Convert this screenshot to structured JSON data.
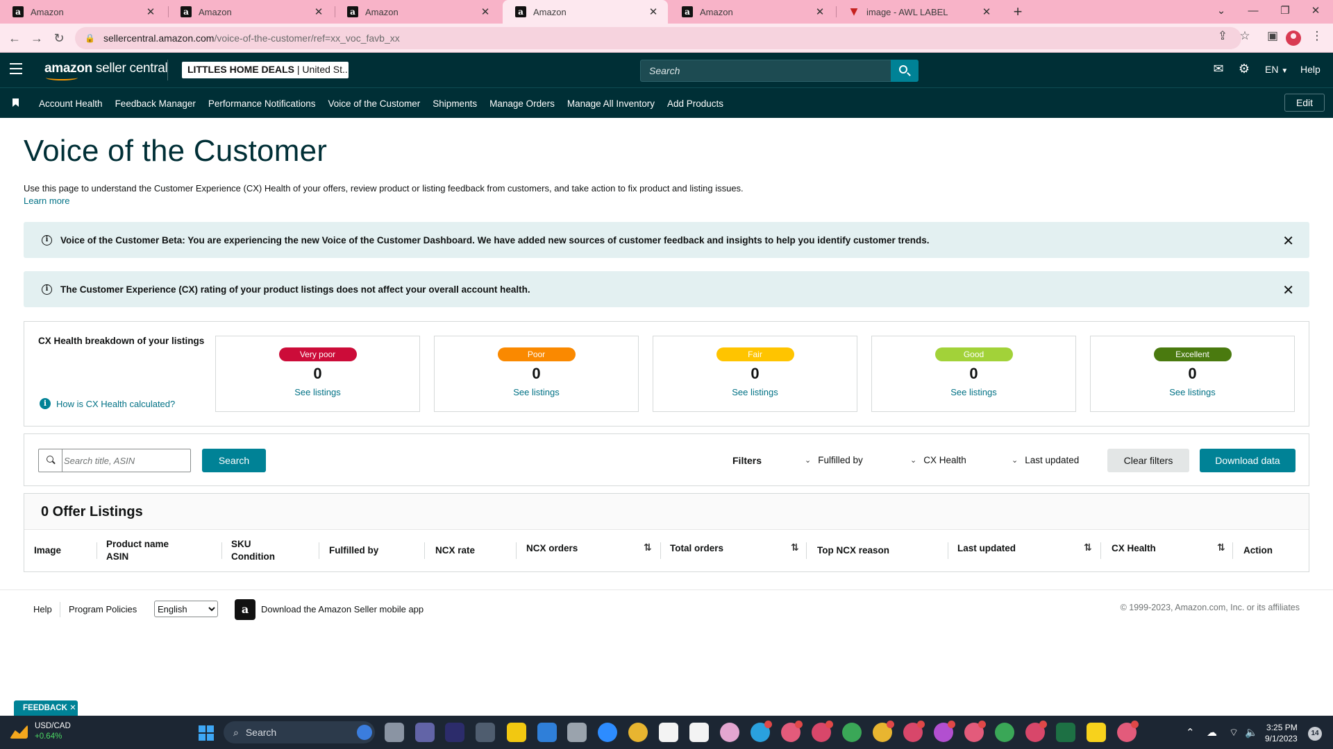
{
  "browser": {
    "tabs": [
      {
        "title": "Amazon",
        "favicon": "amazon-icon",
        "active": false
      },
      {
        "title": "Amazon",
        "favicon": "amazon-icon",
        "active": false
      },
      {
        "title": "Amazon",
        "favicon": "amazon-icon",
        "active": false
      },
      {
        "title": "Amazon",
        "favicon": "amazon-icon",
        "active": true
      },
      {
        "title": "Amazon",
        "favicon": "amazon-icon",
        "active": false
      },
      {
        "title": "image - AWL LABEL",
        "favicon": "awl-label-icon",
        "active": false
      }
    ],
    "url_host": "sellercentral.amazon.com",
    "url_path": "/voice-of-the-customer/ref=xx_voc_favb_xx",
    "tab_color": "#f8b3c8"
  },
  "header": {
    "logo_text_bold": "amazon",
    "logo_text": " seller central",
    "store_name": "LITTLES HOME DEALS",
    "store_region": " | United St...",
    "search_placeholder": "Search",
    "language": "EN",
    "help": "Help",
    "bg_color": "#002f36"
  },
  "nav": {
    "items": [
      "Account Health",
      "Feedback Manager",
      "Performance Notifications",
      "Voice of the Customer",
      "Shipments",
      "Manage Orders",
      "Manage All Inventory",
      "Add Products"
    ],
    "edit_label": "Edit"
  },
  "page": {
    "title": "Voice of the Customer",
    "description": "Use this page to understand the Customer Experience (CX) Health of your offers, review product or listing feedback from customers, and take action to fix product and listing issues.",
    "learn_more": "Learn more"
  },
  "banners": [
    {
      "text": "Voice of the Customer Beta: You are experiencing the new Voice of the Customer Dashboard. We have added new sources of customer feedback and insights to help you identify customer trends."
    },
    {
      "text": "The Customer Experience (CX) rating of your product listings does not affect your overall account health."
    }
  ],
  "cx_health": {
    "title": "CX Health breakdown of your listings",
    "how_link": "How is CX Health calculated?",
    "cards": [
      {
        "label": "Very poor",
        "count": "0",
        "link": "See listings",
        "color": "#cc0c39"
      },
      {
        "label": "Poor",
        "count": "0",
        "link": "See listings",
        "color": "#fa8900"
      },
      {
        "label": "Fair",
        "count": "0",
        "link": "See listings",
        "color": "#ffc400"
      },
      {
        "label": "Good",
        "count": "0",
        "link": "See listings",
        "color": "#a2d239"
      },
      {
        "label": "Excellent",
        "count": "0",
        "link": "See listings",
        "color": "#4a7a0f"
      }
    ]
  },
  "filters": {
    "search_placeholder": "Search title, ASIN",
    "search_button": "Search",
    "filters_label": "Filters",
    "dropdowns": [
      "Fulfilled by",
      "CX Health",
      "Last updated"
    ],
    "clear_button": "Clear filters",
    "download_button": "Download data"
  },
  "listings": {
    "heading": "0 Offer Listings",
    "columns": [
      {
        "line1": "Image",
        "line2": ""
      },
      {
        "line1": "Product name",
        "line2": "ASIN"
      },
      {
        "line1": "SKU",
        "line2": "Condition"
      },
      {
        "line1": "Fulfilled by",
        "line2": ""
      },
      {
        "line1": "NCX rate",
        "line2": ""
      },
      {
        "line1": "NCX orders",
        "line2": ""
      },
      {
        "line1": "Total orders",
        "line2": ""
      },
      {
        "line1": "Top NCX reason",
        "line2": ""
      },
      {
        "line1": "Last updated",
        "line2": ""
      },
      {
        "line1": "CX Health",
        "line2": ""
      },
      {
        "line1": "Action",
        "line2": ""
      }
    ]
  },
  "footer": {
    "help": "Help",
    "program_policies": "Program Policies",
    "language": "English",
    "app_link": "Download the Amazon Seller mobile app",
    "copyright": "© 1999-2023, Amazon.com, Inc. or its affiliates"
  },
  "feedback_tab": "FEEDBACK ✕",
  "taskbar": {
    "ticker_name": "USD/CAD",
    "ticker_change": "+0.64%",
    "search_label": "Search",
    "time": "3:25 PM",
    "date": "9/1/2023",
    "notification_count": "14"
  }
}
